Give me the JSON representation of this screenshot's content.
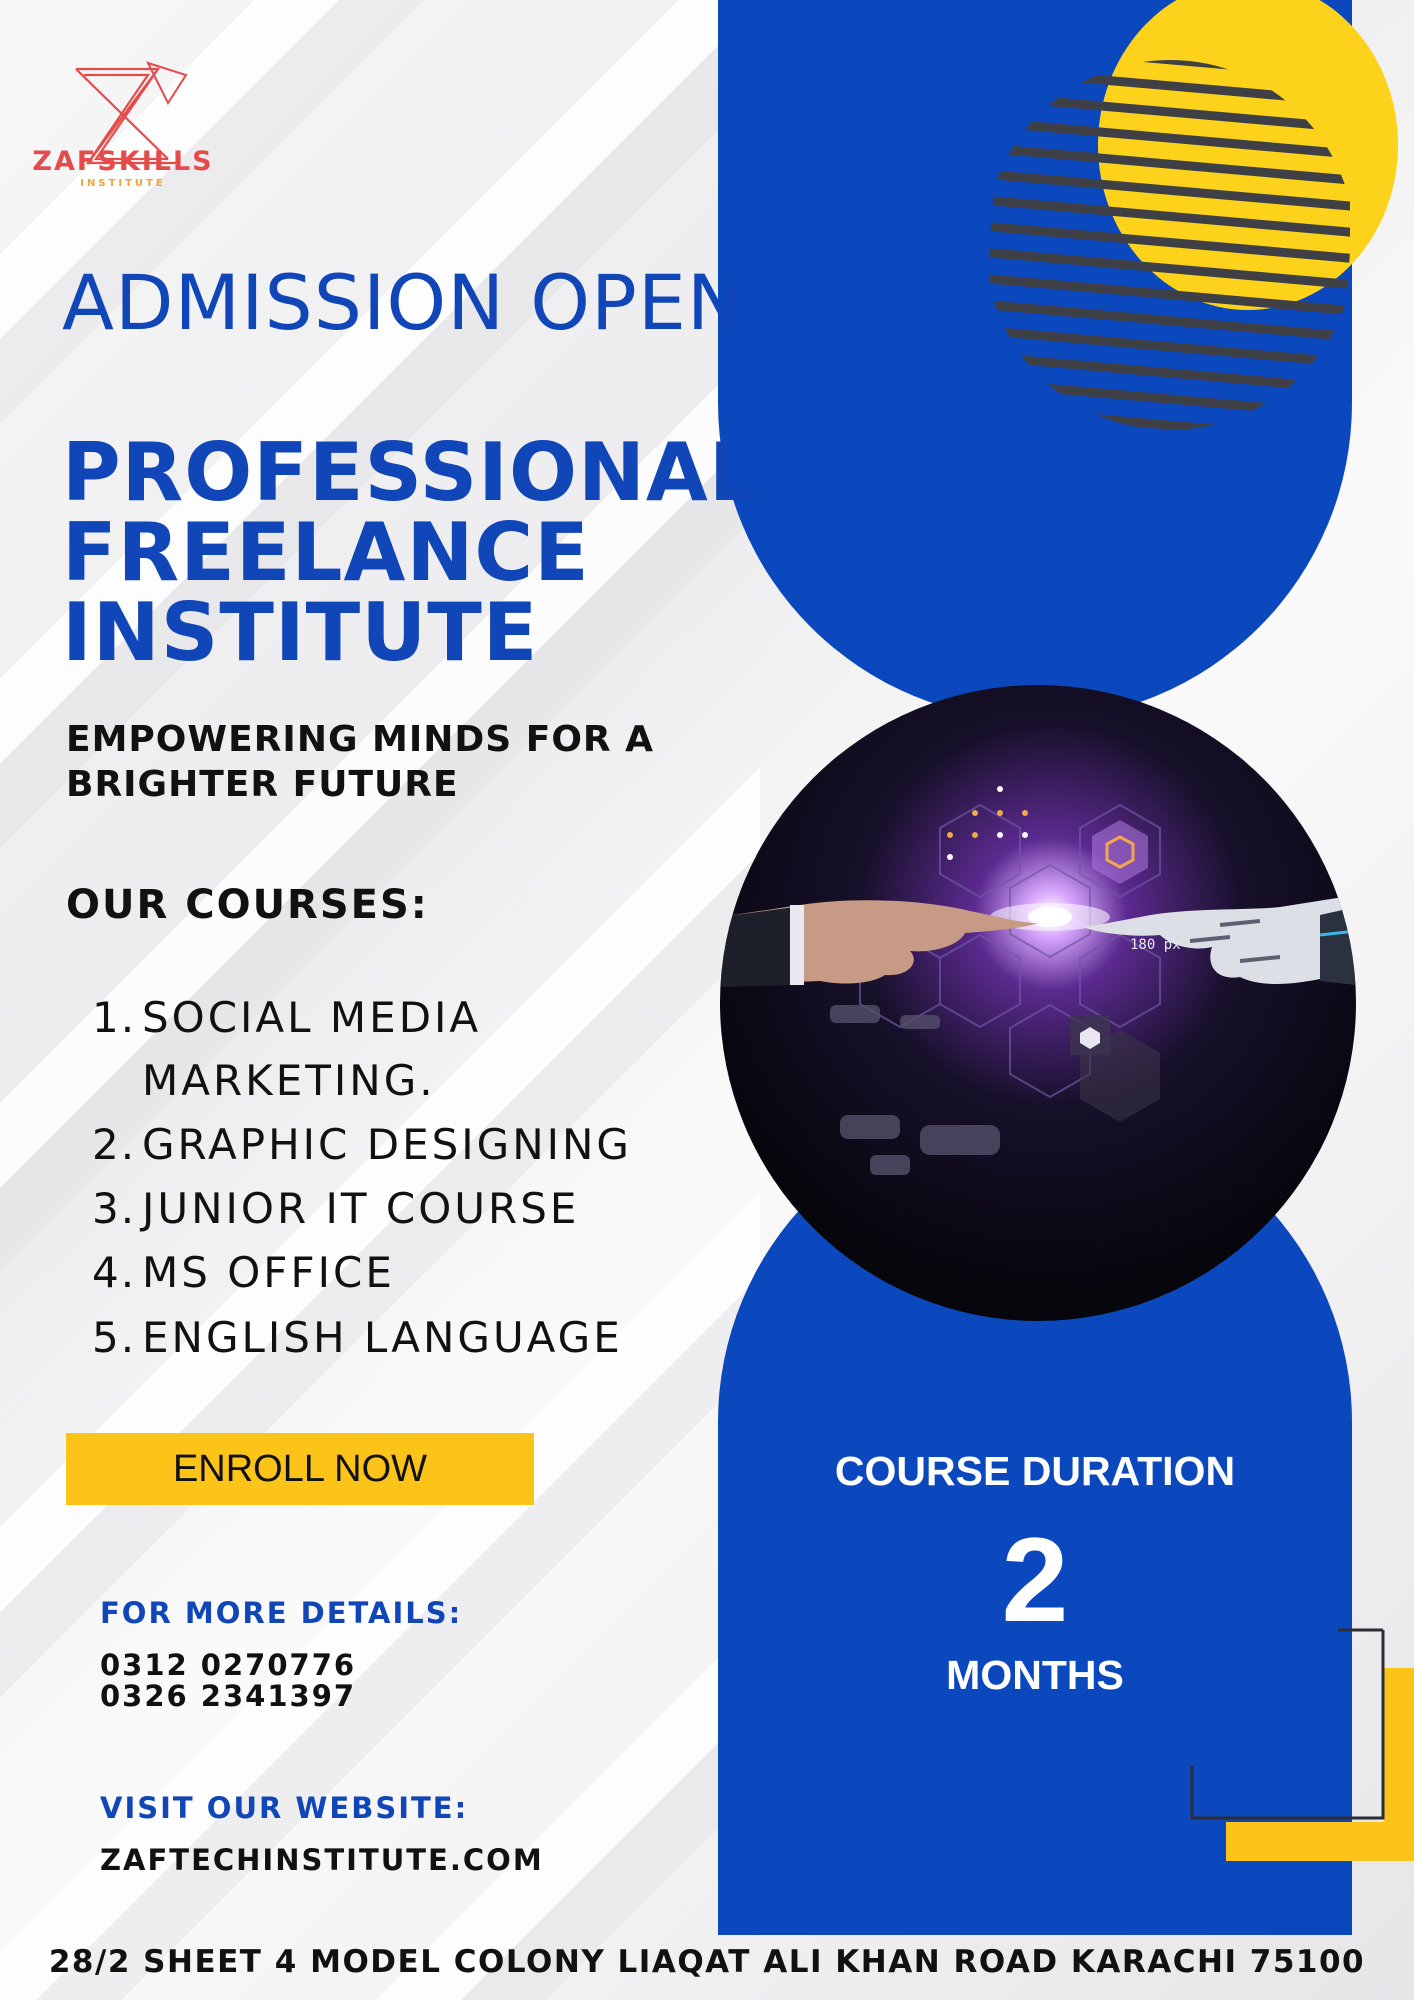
{
  "logo": {
    "name": "ZAFSKILLS",
    "sub": "INSTITUTE"
  },
  "header": {
    "announcement": "ADMISSION OPEN"
  },
  "title": {
    "lines": [
      "PROFESSIONAL",
      "FREELANCE",
      "INSTITUTE"
    ]
  },
  "tagline": {
    "lines": [
      "EMPOWERING MINDS FOR A",
      "BRIGHTER FUTURE"
    ]
  },
  "courses": {
    "heading": "OUR COURSES:",
    "items": [
      {
        "num": "1.",
        "lines": [
          "SOCIAL MEDIA",
          "MARKETING."
        ]
      },
      {
        "num": "2.",
        "lines": [
          "GRAPHIC DESIGNING"
        ]
      },
      {
        "num": "3.",
        "lines": [
          "JUNIOR IT COURSE"
        ]
      },
      {
        "num": "4.",
        "lines": [
          "MS OFFICE"
        ]
      },
      {
        "num": "5.",
        "lines": [
          "ENGLISH LANGUAGE"
        ]
      }
    ]
  },
  "cta": {
    "enroll_label": "ENROLL NOW"
  },
  "contact": {
    "details_heading": "FOR MORE DETAILS:",
    "phones": [
      "0312 0270776",
      "0326 2341397"
    ],
    "website_heading": "VISIT OUR WEBSITE:",
    "website": "ZAFTECHINSTITUTE.COM"
  },
  "duration": {
    "label": "COURSE DURATION",
    "value": "2",
    "unit": "MONTHS"
  },
  "image": {
    "hologram_text": "180 px"
  },
  "footer": {
    "address": "28/2 SHEET 4 MODEL COLONY LIAQAT ALI KHAN ROAD KARACHI 75100"
  },
  "colors": {
    "brand_blue": "#0c48bd",
    "accent_yellow": "#fcd31a",
    "logo_red": "#e54b4b"
  }
}
